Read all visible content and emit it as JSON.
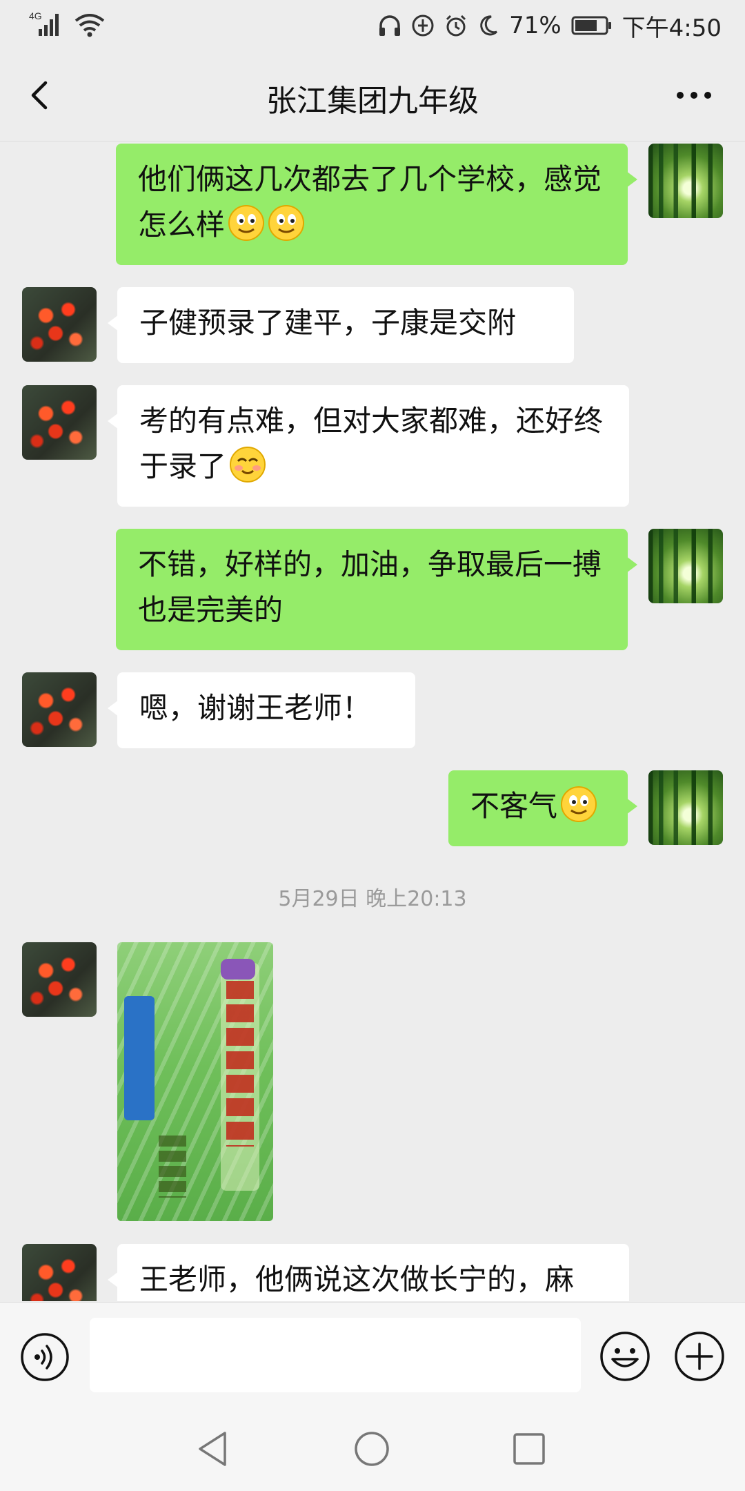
{
  "status_bar": {
    "network": "4G",
    "battery_percent": "71%",
    "time": "下午4:50"
  },
  "header": {
    "title": "张江集团九年级"
  },
  "messages": [
    {
      "side": "right",
      "text": "他们俩这几次都去了几个学校，感觉怎么样",
      "emojis": [
        "smile-emoji",
        "smile-emoji"
      ]
    },
    {
      "side": "left",
      "text": "子健预录了建平，子康是交附"
    },
    {
      "side": "left",
      "text": "考的有点难，但对大家都难，还好终于录了",
      "emojis": [
        "blush-emoji"
      ]
    },
    {
      "side": "right",
      "text": "不错，好样的，加油，争取最后一搏也是完美的"
    },
    {
      "side": "left",
      "text": "嗯，谢谢王老师！"
    },
    {
      "side": "right",
      "text": "不客气",
      "emojis": [
        "smile-emoji"
      ]
    },
    {
      "side": "left",
      "text": "王老师，他俩说这次做长宁的，麻"
    }
  ],
  "timestamp": "5月29日 晚上20:13",
  "colors": {
    "outgoing_bubble": "#95ec69",
    "incoming_bubble": "#ffffff",
    "background": "#ededed"
  },
  "icons": {
    "back": "chevron-left-icon",
    "more": "more-dots-icon",
    "voice": "voice-icon",
    "emoji": "emoji-icon",
    "plus": "plus-icon"
  }
}
